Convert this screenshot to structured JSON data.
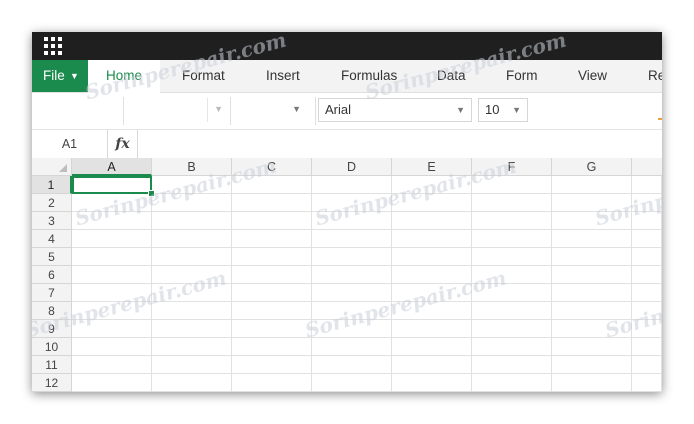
{
  "menubar": {
    "file_label": "File",
    "tabs": [
      "Home",
      "Format",
      "Insert",
      "Formulas",
      "Data",
      "Form",
      "View",
      "Re"
    ]
  },
  "toolbar": {
    "font_name": "Arial",
    "font_size": "10"
  },
  "formula_bar": {
    "cell_ref": "A1",
    "fx_label": "fx",
    "value": ""
  },
  "grid": {
    "columns": [
      "A",
      "B",
      "C",
      "D",
      "E",
      "F",
      "G"
    ],
    "rows": [
      "1",
      "2",
      "3",
      "4",
      "5",
      "6",
      "7",
      "8",
      "9",
      "10",
      "11",
      "12"
    ],
    "active_cell": "A1"
  },
  "watermark": "Sorinperepair.com",
  "colors": {
    "accent": "#1a8b4c",
    "topbar": "#1f1f1f",
    "menubar": "#f3f3f3"
  },
  "icons": [
    "apps-grid-icon",
    "chevron-down-icon",
    "corner-select-icon"
  ]
}
